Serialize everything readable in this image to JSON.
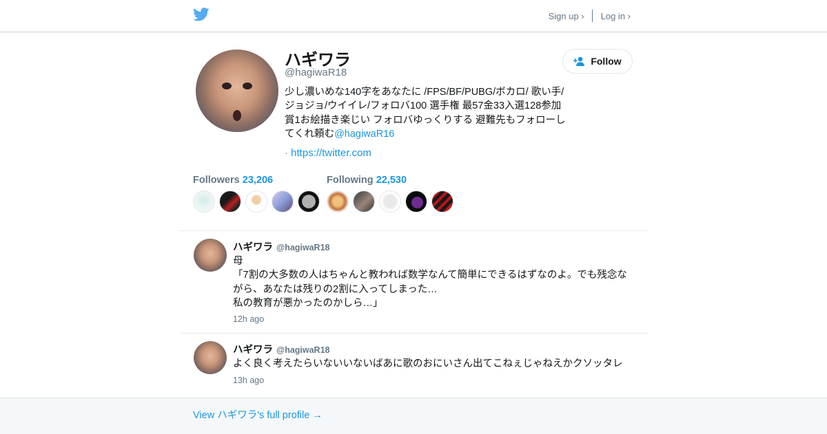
{
  "topbar": {
    "logo_icon": "twitter-bird-icon",
    "signup_label": "Sign up ›",
    "login_label": "Log in ›"
  },
  "profile": {
    "name": "ハギワラ",
    "handle": "@hagiwaR18",
    "bio": "少し濃いめな140字をあなたに /FPS/BF/PUBG/ボカロ/ 歌い手/ジョジョ/ウイイレ/フォロバ100 選手権 最57金33入選128参加賞1お絵描き楽じい フォロバゆっくりする 避難先もフォローしてくれ頼む",
    "bio_mention": "@hagiwaR16",
    "url_prefix": "·",
    "url": "https://twitter.com",
    "follow_label": "Follow"
  },
  "stats": {
    "followers_label": "Followers",
    "followers_count": "23,206",
    "following_label": "Following",
    "following_count": "22,530"
  },
  "tweets": [
    {
      "name": "ハギワラ",
      "handle": "@hagiwaR18",
      "text": "母\n「7割の大多数の人はちゃんと教われば数学なんて簡単にできるはずなのよ。でも残念ながら、あなたは残りの2割に入ってしまった…\n私の教育が悪かったのかしら…」",
      "time": "12h ago"
    },
    {
      "name": "ハギワラ",
      "handle": "@hagiwaR18",
      "text": "よく良く考えたらいないいないばあに歌のおにいさん出てこねぇじゃねえかクソッタレ",
      "time": "13h ago"
    }
  ],
  "footer": {
    "link_label": "View ハギワラ's full profile →"
  },
  "colors": {
    "accent": "#1b95e0",
    "twitter_blue": "#55acee",
    "muted": "#657786"
  }
}
